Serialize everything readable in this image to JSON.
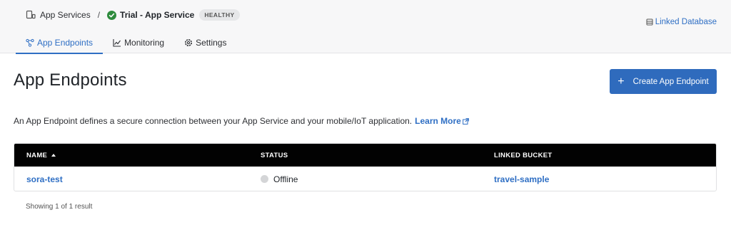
{
  "breadcrumb": {
    "parent_label": "App Services",
    "separator": "/",
    "service_name": "Trial - App Service",
    "health_badge": "HEALTHY"
  },
  "header": {
    "linked_database_label": "Linked Database"
  },
  "tabs": [
    {
      "label": "App Endpoints",
      "icon": "endpoints-icon",
      "active": true
    },
    {
      "label": "Monitoring",
      "icon": "chart-icon",
      "active": false
    },
    {
      "label": "Settings",
      "icon": "gear-icon",
      "active": false
    }
  ],
  "main": {
    "title": "App Endpoints",
    "create_button_label": "Create App Endpoint",
    "description": "An App Endpoint defines a secure connection between your App Service and your mobile/IoT application.",
    "learn_more_label": "Learn More"
  },
  "table": {
    "columns": [
      "NAME",
      "STATUS",
      "LINKED BUCKET"
    ],
    "sort_column": "NAME",
    "sort_direction": "ascending",
    "rows": [
      {
        "name": "sora-test",
        "status": "Offline",
        "linked_bucket": "travel-sample"
      }
    ]
  },
  "pagination": {
    "summary": "Showing 1 of 1 result"
  },
  "colors": {
    "accent": "#2f6fc4",
    "button_primary": "#2f6bbd",
    "table_header_bg": "#020202",
    "healthy_green": "#2e8b3d",
    "offline_gray": "#d4d5d7"
  }
}
